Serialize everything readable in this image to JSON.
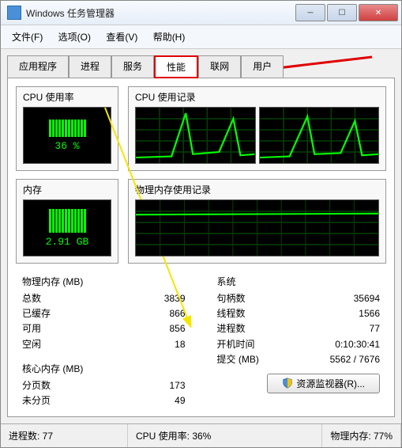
{
  "window": {
    "title": "Windows 任务管理器"
  },
  "menu": {
    "file": "文件(F)",
    "options": "选项(O)",
    "view": "查看(V)",
    "help": "帮助(H)"
  },
  "tabs": {
    "apps": "应用程序",
    "procs": "进程",
    "services": "服务",
    "perf": "性能",
    "net": "联网",
    "users": "用户"
  },
  "gauges": {
    "cpu": {
      "title": "CPU 使用率",
      "value": "36 %"
    },
    "mem": {
      "title": "内存",
      "value": "2.91 GB"
    },
    "cpu_hist": "CPU 使用记录",
    "mem_hist": "物理内存使用记录"
  },
  "phys": {
    "header": "物理内存 (MB)",
    "total_l": "总数",
    "total_v": "3839",
    "cached_l": "已缓存",
    "cached_v": "866",
    "avail_l": "可用",
    "avail_v": "856",
    "free_l": "空闲",
    "free_v": "18"
  },
  "kernel": {
    "header": "核心内存 (MB)",
    "paged_l": "分页数",
    "paged_v": "173",
    "nonpaged_l": "未分页",
    "nonpaged_v": "49"
  },
  "sys": {
    "header": "系统",
    "handles_l": "句柄数",
    "handles_v": "35694",
    "threads_l": "线程数",
    "threads_v": "1566",
    "procs_l": "进程数",
    "procs_v": "77",
    "uptime_l": "开机时间",
    "uptime_v": "0:10:30:41",
    "commit_l": "提交 (MB)",
    "commit_v": "5562 / 7676"
  },
  "resmon": {
    "label": "资源监视器(R)..."
  },
  "status": {
    "procs": "进程数: 77",
    "cpu": "CPU 使用率: 36%",
    "mem": "物理内存: 77%"
  }
}
